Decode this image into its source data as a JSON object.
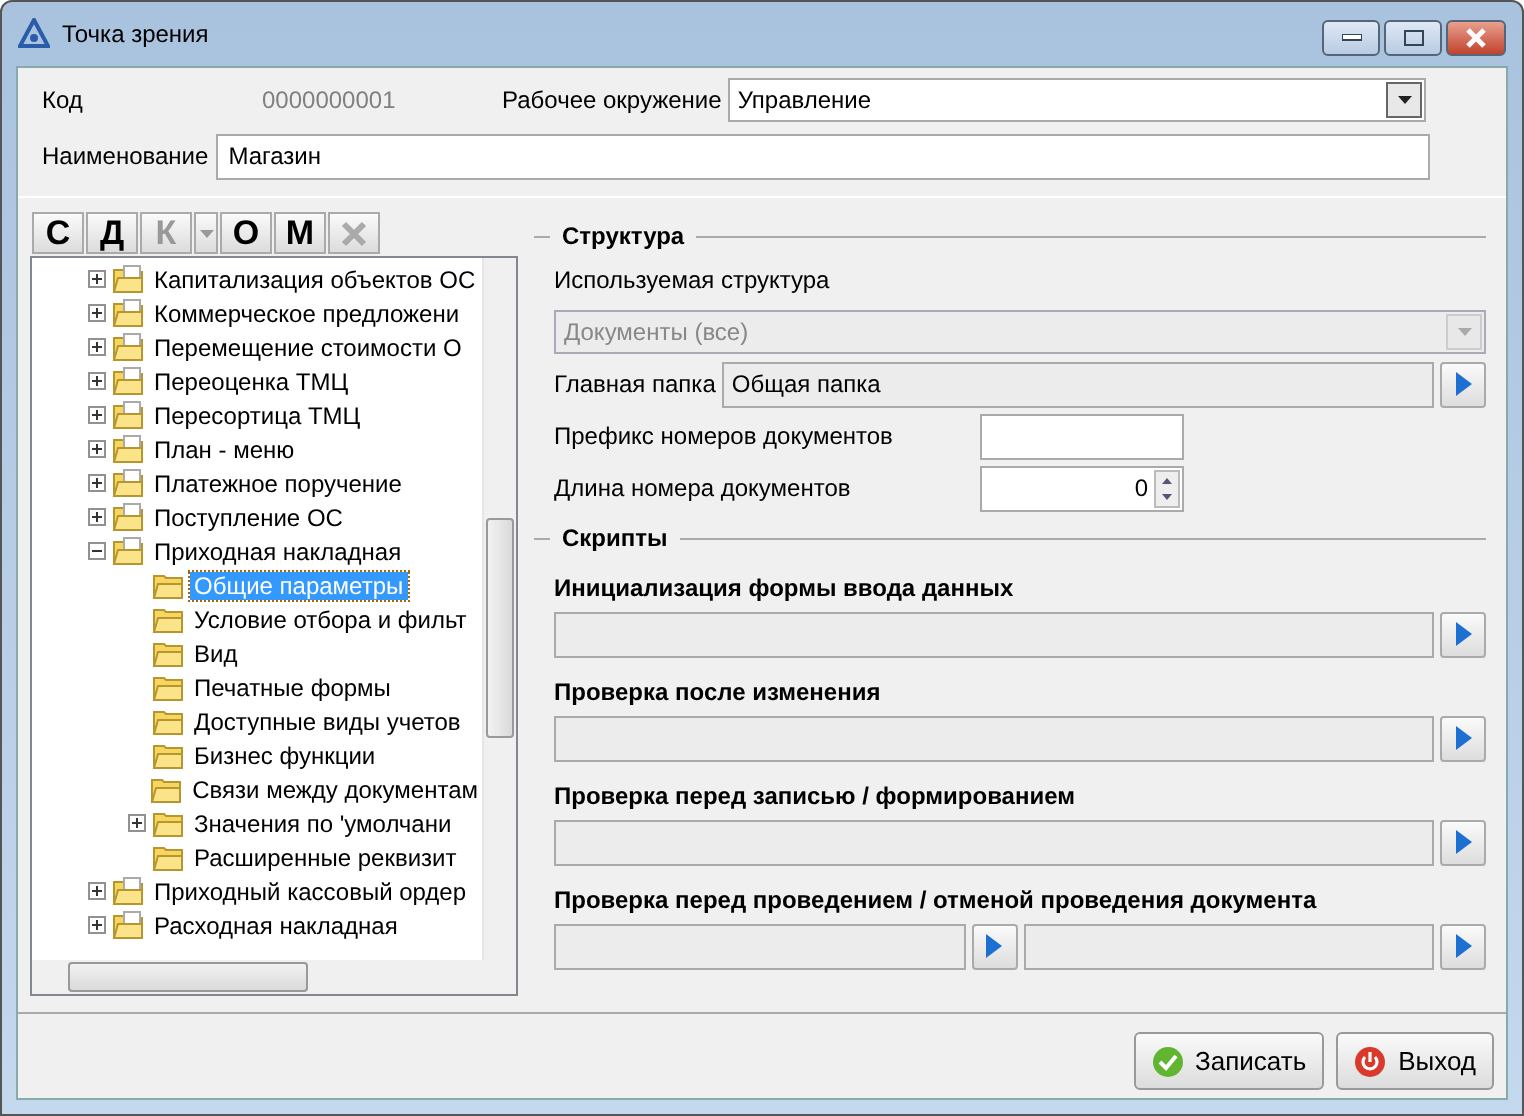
{
  "window": {
    "title": "Точка зрения"
  },
  "header": {
    "code_label": "Код",
    "code_value": "0000000001",
    "env_label": "Рабочее окружение",
    "env_value": "Управление",
    "name_label": "Наименование",
    "name_value": "Магазин"
  },
  "toolbar": [
    {
      "kind": "text",
      "label": "С",
      "disabled": false
    },
    {
      "kind": "text",
      "label": "Д",
      "disabled": false
    },
    {
      "kind": "split",
      "label": "К",
      "disabled": true
    },
    {
      "kind": "text",
      "label": "О",
      "disabled": false
    },
    {
      "kind": "text",
      "label": "М",
      "disabled": false
    },
    {
      "kind": "delete",
      "disabled": true
    }
  ],
  "tree": [
    {
      "label": "Капитализация объектов ОС",
      "expanded": false,
      "selected": false
    },
    {
      "label": "Коммерческое предложени",
      "expanded": false,
      "selected": false
    },
    {
      "label": "Перемещение стоимости О",
      "expanded": false,
      "selected": false
    },
    {
      "label": "Переоценка ТМЦ",
      "expanded": false,
      "selected": false
    },
    {
      "label": "Пересортица ТМЦ",
      "expanded": false,
      "selected": false
    },
    {
      "label": "План - меню",
      "expanded": false,
      "selected": false
    },
    {
      "label": "Платежное поручение",
      "expanded": false,
      "selected": false
    },
    {
      "label": "Поступление ОС",
      "expanded": false,
      "selected": false
    },
    {
      "label": "Приходная накладная",
      "expanded": true,
      "selected": false,
      "children": [
        {
          "label": "Общие параметры",
          "selected": true
        },
        {
          "label": "Условие отбора и фильт",
          "selected": false
        },
        {
          "label": "Вид",
          "selected": false
        },
        {
          "label": "Печатные формы",
          "selected": false
        },
        {
          "label": "Доступные виды учетов",
          "selected": false
        },
        {
          "label": "Бизнес функции",
          "selected": false
        },
        {
          "label": "Связи между документам",
          "selected": false
        },
        {
          "label": "Значения по 'умолчани",
          "expanded": false,
          "selected": false
        },
        {
          "label": "Расширенные реквизит",
          "selected": false
        }
      ]
    },
    {
      "label": "Приходный кассовый ордер",
      "expanded": false,
      "selected": false
    },
    {
      "label": "Расходная накладная",
      "expanded": false,
      "selected": false
    }
  ],
  "structure": {
    "legend": "Структура",
    "used_label": "Используемая структура",
    "used_value": "Документы (все)",
    "used_disabled": true,
    "folder_label": "Главная папка",
    "folder_value": "Общая папка",
    "prefix_label": "Префикс номеров документов",
    "length_label": "Длина номера документов",
    "length_value": "0"
  },
  "scripts": {
    "legend": "Скрипты",
    "items": [
      {
        "label": "Инициализация формы ввода данных",
        "kind": "single"
      },
      {
        "label": "Проверка после изменения",
        "kind": "single"
      },
      {
        "label": "Проверка перед записью / формированием",
        "kind": "single"
      },
      {
        "label": "Проверка перед проведением / отменой проведения документа",
        "kind": "pair"
      }
    ]
  },
  "buttons": [
    {
      "kind": "save",
      "label": "Записать"
    },
    {
      "kind": "exit",
      "label": "Выход"
    }
  ]
}
